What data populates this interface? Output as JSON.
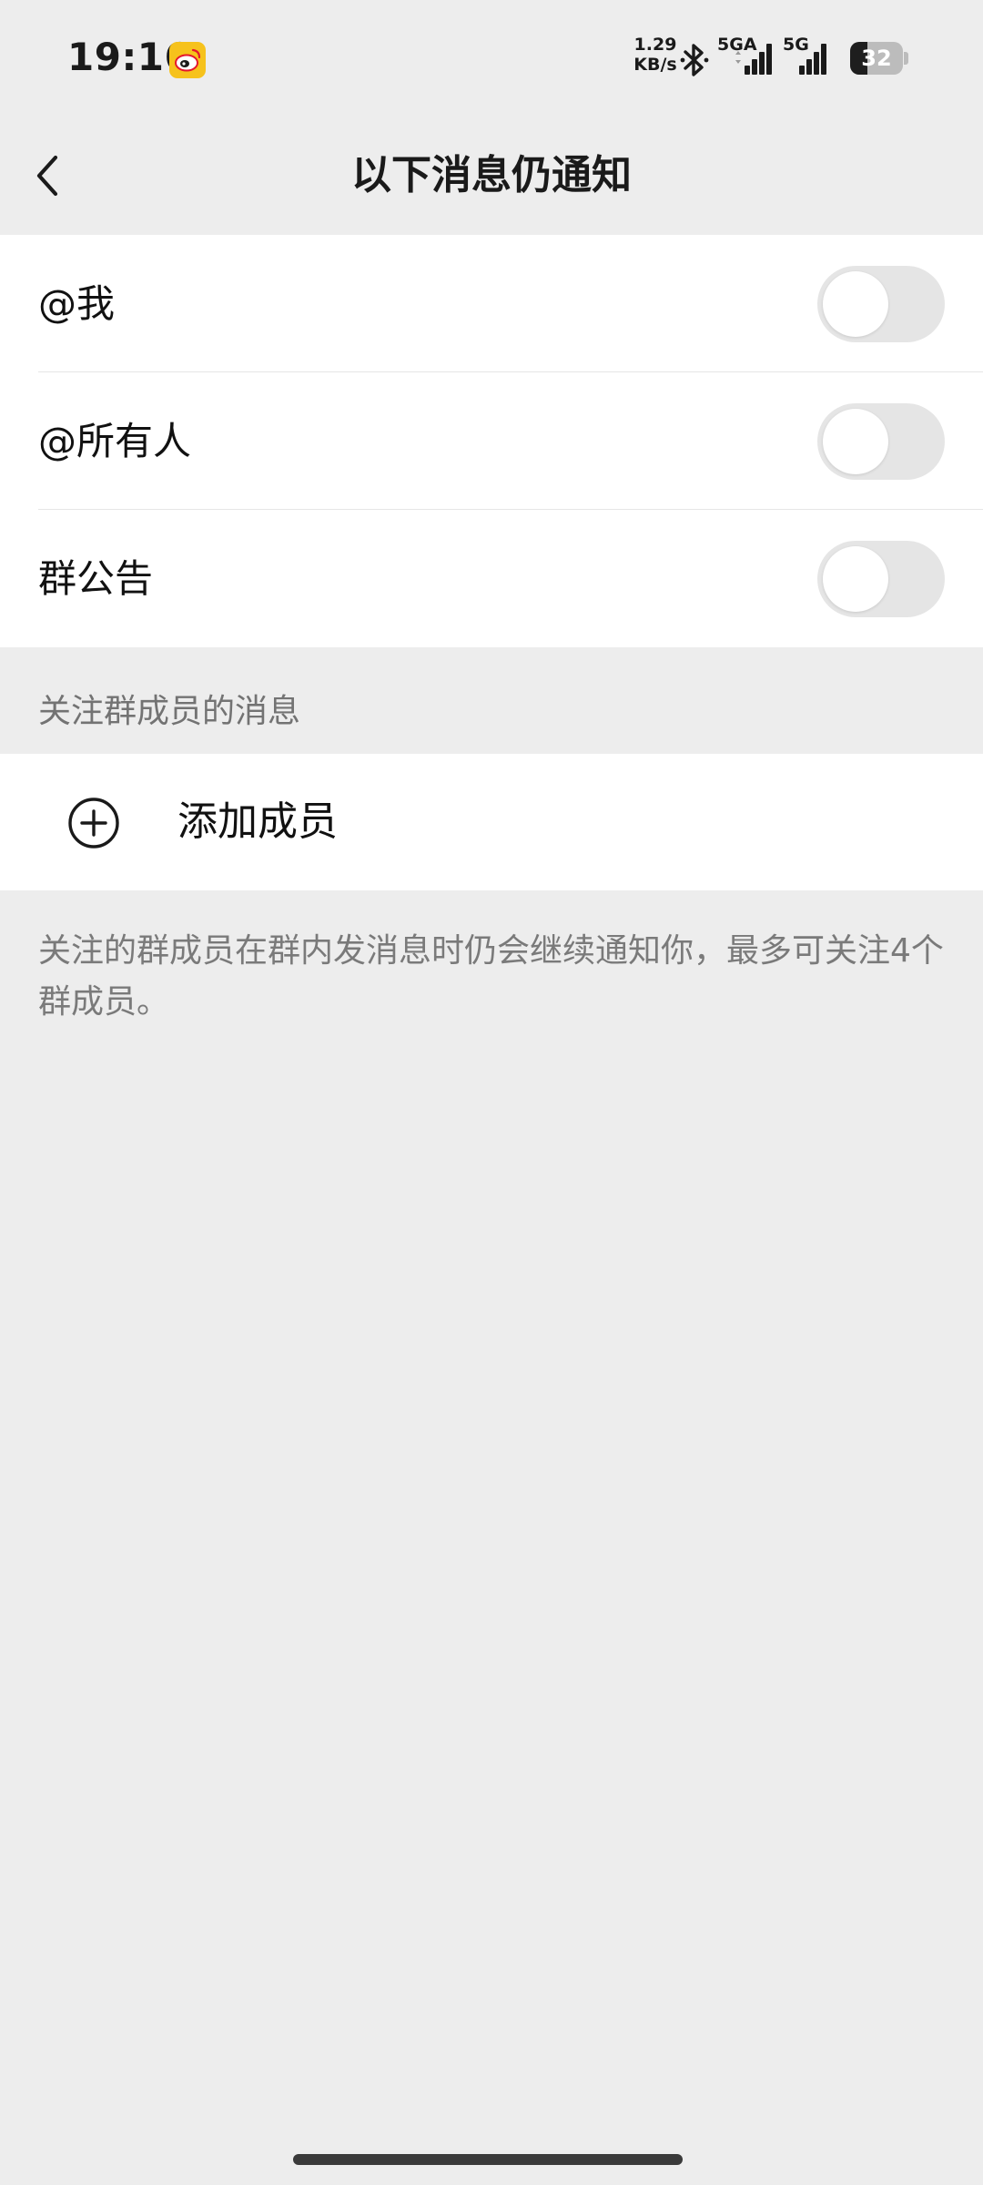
{
  "status_bar": {
    "time": "19:16",
    "net_speed_value": "1.29",
    "net_speed_unit": "KB/s",
    "signal1_label": "5GA",
    "signal2_label": "5G",
    "battery_percent": "32",
    "battery_level": 0.32,
    "icons": [
      "weibo-icon",
      "bluetooth-icon",
      "signal-icon",
      "battery-icon"
    ]
  },
  "nav": {
    "title": "以下消息仍通知",
    "back_icon": "chevron-left-icon"
  },
  "toggles": [
    {
      "label": "@我",
      "on": false
    },
    {
      "label": "@所有人",
      "on": false
    },
    {
      "label": "群公告",
      "on": false
    }
  ],
  "follow_section": {
    "header": "关注群成员的消息",
    "add_label": "添加成员",
    "add_icon": "plus-circle-icon"
  },
  "footnote": "关注的群成员在群内发消息时仍会继续通知你，最多可关注4个群成员。",
  "colors": {
    "background": "#ededed",
    "card": "#ffffff",
    "toggle_off": "#e5e5e5",
    "secondary_text": "#7a7a7a"
  }
}
